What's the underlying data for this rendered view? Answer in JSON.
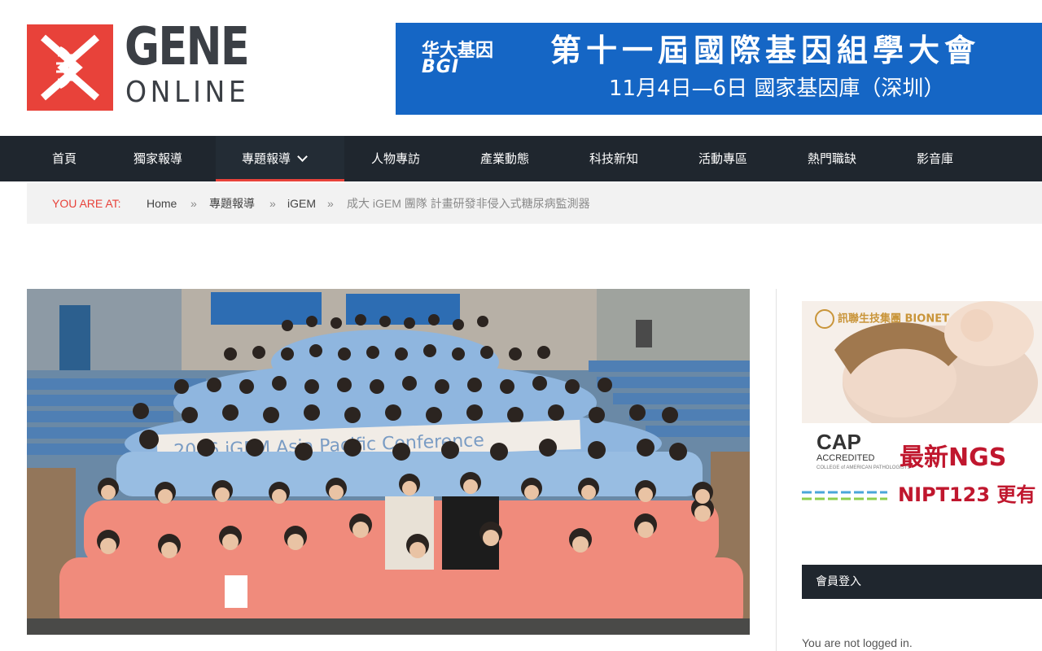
{
  "logo": {
    "word1": "GENE",
    "word2": "ONLINE",
    "brand_color": "#e8423a"
  },
  "banner": {
    "brand_line1": "华大基因",
    "brand_line2": "BGI",
    "title": "第十一屆國際基因組學大會",
    "subtitle": "11月4日—6日  國家基因庫（深圳）",
    "background": "#1566c5"
  },
  "nav": {
    "items": [
      {
        "label": "首頁"
      },
      {
        "label": "獨家報導"
      },
      {
        "label": "專題報導",
        "active": true,
        "has_dropdown": true
      },
      {
        "label": "人物專訪"
      },
      {
        "label": "產業動態"
      },
      {
        "label": "科技新知"
      },
      {
        "label": "活動專區"
      },
      {
        "label": "熱門職缺"
      },
      {
        "label": "影音庫"
      }
    ]
  },
  "breadcrumb": {
    "prefix": "YOU ARE AT:",
    "separator": "»",
    "items": [
      "Home",
      "專題報導",
      "iGEM",
      "成大 iGEM 團隊 計畫研發非侵入式糖尿病監測器"
    ]
  },
  "photo": {
    "banner_text": "2016 iGEM Asia Pacific Conference"
  },
  "sidebar": {
    "ad": {
      "logo_text": "訊聯生技集團 BIONET",
      "cap": "CAP",
      "accredited": "ACCREDITED",
      "college": "COLLEGE of AMERICAN PATHOLOGISTS",
      "headline": "最新NGS",
      "sub": "NIPT123 更有"
    },
    "login": {
      "title": "會員登入",
      "status": "You are not logged in."
    }
  },
  "colors": {
    "nav_bg": "#1f262e",
    "accent": "#e8423a",
    "breadcrumb_bg": "#f2f2f2"
  }
}
